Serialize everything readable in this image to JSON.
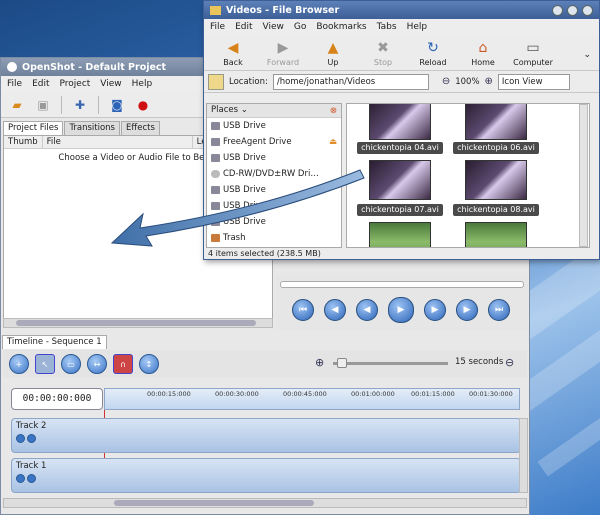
{
  "openshot": {
    "title": "OpenShot - Default Project",
    "menu": [
      "File",
      "Edit",
      "Project",
      "View",
      "Help"
    ],
    "tabs": [
      "Project Files",
      "Transitions",
      "Effects"
    ],
    "file_columns": [
      "Thumb",
      "File",
      "Le"
    ],
    "empty_message": "Choose a Video or Audio File to Begin",
    "timeline_tab": "Timeline - Sequence 1",
    "zoom_label": "15 seconds",
    "timecode": "00:00:00:000",
    "ruler_labels": [
      "00:00:15:000",
      "00:00:30:000",
      "00:00:45:000",
      "00:01:00:000",
      "00:01:15:000",
      "00:01:30:000"
    ],
    "tracks": [
      {
        "name": "Track 2"
      },
      {
        "name": "Track 1"
      }
    ]
  },
  "filebrowser": {
    "title": "Videos - File Browser",
    "menu": [
      "File",
      "Edit",
      "View",
      "Go",
      "Bookmarks",
      "Tabs",
      "Help"
    ],
    "toolbar": [
      {
        "label": "Back",
        "icon": "back-arrow-icon",
        "enabled": true
      },
      {
        "label": "Forward",
        "icon": "forward-arrow-icon",
        "enabled": false
      },
      {
        "label": "Up",
        "icon": "up-arrow-icon",
        "enabled": true
      },
      {
        "label": "Stop",
        "icon": "stop-icon",
        "enabled": false
      },
      {
        "label": "Reload",
        "icon": "reload-icon",
        "enabled": true
      },
      {
        "label": "Home",
        "icon": "home-icon",
        "enabled": true
      },
      {
        "label": "Computer",
        "icon": "computer-icon",
        "enabled": true
      }
    ],
    "location_label": "Location:",
    "location_value": "/home/jonathan/Videos",
    "zoom_level": "100%",
    "view_mode": "Icon View",
    "places_header": "Places",
    "places": [
      {
        "label": "USB Drive",
        "icon": "drive-icon"
      },
      {
        "label": "FreeAgent Drive",
        "icon": "drive-icon"
      },
      {
        "label": "USB Drive",
        "icon": "drive-icon"
      },
      {
        "label": "CD-RW/DVD±RW Dri…",
        "icon": "cdrom-icon"
      },
      {
        "label": "USB Drive",
        "icon": "drive-icon"
      },
      {
        "label": "USB Drive",
        "icon": "drive-icon"
      },
      {
        "label": "USB Drive",
        "icon": "drive-icon"
      },
      {
        "label": "Trash",
        "icon": "trash-icon"
      }
    ],
    "files": [
      {
        "name": "chickentopia 04.avi"
      },
      {
        "name": "chickentopia 06.avi"
      },
      {
        "name": "chickentopia 07.avi"
      },
      {
        "name": "chickentopia 08.avi"
      },
      {
        "name": ""
      },
      {
        "name": ""
      }
    ],
    "status": "4 items selected (238.5 MB)"
  }
}
